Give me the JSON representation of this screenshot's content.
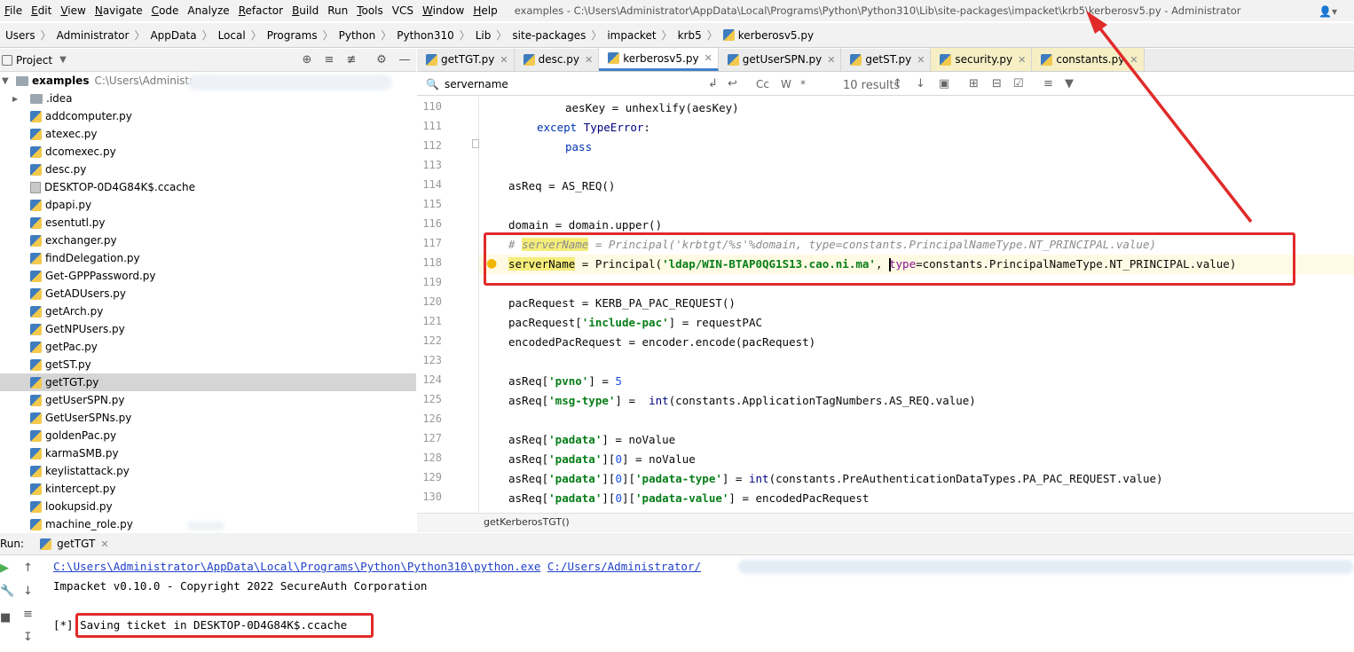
{
  "menu": {
    "items": [
      {
        "mnemonic": "F",
        "rest": "ile"
      },
      {
        "mnemonic": "E",
        "rest": "dit"
      },
      {
        "mnemonic": "V",
        "rest": "iew"
      },
      {
        "mnemonic": "N",
        "rest": "avigate"
      },
      {
        "mnemonic": "C",
        "rest": "ode"
      },
      {
        "mnemonic": "",
        "rest": "Analyze"
      },
      {
        "mnemonic": "R",
        "rest": "efactor"
      },
      {
        "mnemonic": "B",
        "rest": "uild"
      },
      {
        "mnemonic": "",
        "rest": "Run"
      },
      {
        "mnemonic": "T",
        "rest": "ools"
      },
      {
        "mnemonic": "",
        "rest": "VCS"
      },
      {
        "mnemonic": "W",
        "rest": "indow"
      },
      {
        "mnemonic": "H",
        "rest": "elp"
      }
    ],
    "window_title": "examples - C:\\Users\\Administrator\\AppData\\Local\\Programs\\Python\\Python310\\Lib\\site-packages\\impacket\\krb5\\kerberosv5.py - Administrator"
  },
  "breadcrumb": [
    "Users",
    "Administrator",
    "AppData",
    "Local",
    "Programs",
    "Python",
    "Python310",
    "Lib",
    "site-packages",
    "impacket",
    "krb5",
    "kerberosv5.py"
  ],
  "project": {
    "title": "Project",
    "root_name": "examples",
    "root_path": "C:\\Users\\Administrator",
    "items": [
      {
        "name": ".idea",
        "kind": "folder"
      },
      {
        "name": "addcomputer.py",
        "kind": "py"
      },
      {
        "name": "atexec.py",
        "kind": "py"
      },
      {
        "name": "dcomexec.py",
        "kind": "py"
      },
      {
        "name": "desc.py",
        "kind": "py"
      },
      {
        "name": "DESKTOP-0D4G84K$.ccache",
        "kind": "file"
      },
      {
        "name": "dpapi.py",
        "kind": "py"
      },
      {
        "name": "esentutl.py",
        "kind": "py"
      },
      {
        "name": "exchanger.py",
        "kind": "py"
      },
      {
        "name": "findDelegation.py",
        "kind": "py"
      },
      {
        "name": "Get-GPPPassword.py",
        "kind": "py"
      },
      {
        "name": "GetADUsers.py",
        "kind": "py"
      },
      {
        "name": "getArch.py",
        "kind": "py"
      },
      {
        "name": "GetNPUsers.py",
        "kind": "py"
      },
      {
        "name": "getPac.py",
        "kind": "py"
      },
      {
        "name": "getST.py",
        "kind": "py"
      },
      {
        "name": "getTGT.py",
        "kind": "py",
        "selected": true
      },
      {
        "name": "getUserSPN.py",
        "kind": "py"
      },
      {
        "name": "GetUserSPNs.py",
        "kind": "py"
      },
      {
        "name": "goldenPac.py",
        "kind": "py"
      },
      {
        "name": "karmaSMB.py",
        "kind": "py"
      },
      {
        "name": "keylistattack.py",
        "kind": "py"
      },
      {
        "name": "kintercept.py",
        "kind": "py"
      },
      {
        "name": "lookupsid.py",
        "kind": "py"
      },
      {
        "name": "machine_role.py",
        "kind": "py"
      }
    ]
  },
  "tabs": [
    {
      "label": "getTGT.py",
      "active": false,
      "yellow": false
    },
    {
      "label": "desc.py",
      "active": false,
      "yellow": false
    },
    {
      "label": "kerberosv5.py",
      "active": true,
      "yellow": false
    },
    {
      "label": "getUserSPN.py",
      "active": false,
      "yellow": false
    },
    {
      "label": "getST.py",
      "active": false,
      "yellow": false
    },
    {
      "label": "security.py",
      "active": false,
      "yellow": true
    },
    {
      "label": "constants.py",
      "active": false,
      "yellow": true
    }
  ],
  "search": {
    "query": "servername",
    "results": "10 results",
    "cc": "Cc",
    "w": "W",
    "star": "*"
  },
  "editor": {
    "line_numbers": [
      "110",
      "111",
      "112",
      "113",
      "114",
      "115",
      "116",
      "117",
      "118",
      "119",
      "120",
      "121",
      "122",
      "123",
      "124",
      "125",
      "126",
      "127",
      "128",
      "129",
      "130"
    ],
    "code_breadcrumb": "getKerberosTGT()"
  },
  "run": {
    "label": "Run:",
    "tab": "getTGT",
    "line1_link1": "C:\\Users\\Administrator\\AppData\\Local\\Programs\\Python\\Python310\\python.exe",
    "line1_link2": "C:/Users/Administrator/",
    "line2": "Impacket v0.10.0 - Copyright 2022 SecureAuth Corporation",
    "line3_prefix": "[*] ",
    "line3_msg": "Saving ticket in DESKTOP-0D4G84K$.ccache"
  }
}
